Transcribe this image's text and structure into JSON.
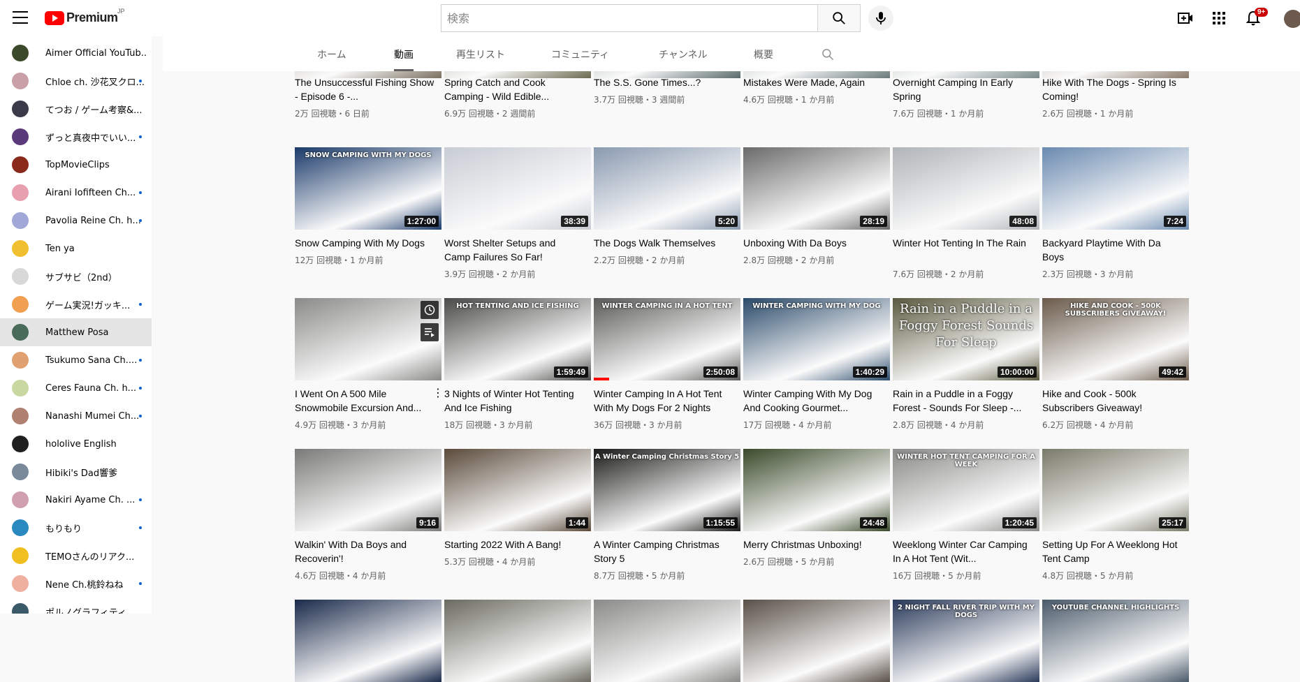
{
  "header": {
    "logo_text": "Premium",
    "logo_region": "JP",
    "search_placeholder": "検索",
    "notification_count": "9+"
  },
  "sidebar": {
    "items": [
      {
        "label": "Aimer Official YouTub...",
        "color": "#3b4a2a",
        "dot": false
      },
      {
        "label": "Chloe ch. 沙花叉クロ...",
        "color": "#c9a0a8",
        "dot": true
      },
      {
        "label": "てつお / ゲーム考察&...",
        "color": "#3a3a4a",
        "dot": false
      },
      {
        "label": "ずっと真夜中でいい...",
        "color": "#5a3a7a",
        "dot": true
      },
      {
        "label": "TopMovieClips",
        "color": "#8a2a1a",
        "dot": false
      },
      {
        "label": "Airani Iofifteen Ch...",
        "color": "#e8a0b0",
        "dot": true
      },
      {
        "label": "Pavolia Reine Ch. h...",
        "color": "#a0a8d8",
        "dot": true
      },
      {
        "label": "Ten ya",
        "color": "#f0c030",
        "dot": false
      },
      {
        "label": "サブサビ（2nd）",
        "color": "#d8d8d8",
        "dot": false
      },
      {
        "label": "ゲーム実況!ガッキ...",
        "color": "#f0a050",
        "dot": true
      },
      {
        "label": "Matthew Posa",
        "color": "#4a6a5a",
        "dot": false,
        "active": true
      },
      {
        "label": "Tsukumo Sana Ch....",
        "color": "#e0a070",
        "dot": true
      },
      {
        "label": "Ceres Fauna Ch. h...",
        "color": "#c8d8a0",
        "dot": true
      },
      {
        "label": "Nanashi Mumei Ch...",
        "color": "#b08070",
        "dot": true
      },
      {
        "label": "hololive English",
        "color": "#202020",
        "dot": false
      },
      {
        "label": "Hibiki's Dad響爹",
        "color": "#7a8a9a",
        "dot": false
      },
      {
        "label": "Nakiri Ayame Ch. ...",
        "color": "#d0a0b0",
        "dot": true
      },
      {
        "label": "もりもり",
        "color": "#2a8ac0",
        "dot": true
      },
      {
        "label": "TEMOさんのリアク...",
        "color": "#f0c020",
        "dot": false
      },
      {
        "label": "Nene Ch.桃鈴ねね",
        "color": "#f0b0a0",
        "dot": true
      },
      {
        "label": "ポルノグラフィティ",
        "color": "#3a5a6a",
        "dot": false
      }
    ]
  },
  "tabs": [
    "ホーム",
    "動画",
    "再生リスト",
    "コミュニティ",
    "チャンネル",
    "概要"
  ],
  "active_tab": "動画",
  "rows": [
    [
      {
        "title": "The Unsuccessful Fishing Show - Episode 6 -...",
        "meta": "2万 回視聴・6 日前",
        "color": "#7a7060"
      },
      {
        "title": "Spring Catch and Cook Camping - Wild Edible...",
        "meta": "6.9万 回視聴・2 週間前",
        "color": "#6a6a50"
      },
      {
        "title": "The S.S. Gone Times...?",
        "meta": "3.7万 回視聴・3 週間前",
        "color": "#5a6a6a"
      },
      {
        "title": "Mistakes Were Made, Again",
        "meta": "4.6万 回視聴・1 か月前",
        "color": "#6a7a7a"
      },
      {
        "title": "Overnight Camping In Early Spring",
        "meta": "7.6万 回視聴・1 か月前",
        "color": "#7a8a8a"
      },
      {
        "title": "Hike With The Dogs - Spring Is Coming!",
        "meta": "2.6万 回視聴・1 か月前",
        "color": "#8a7a6a"
      }
    ],
    [
      {
        "title": "Snow Camping With My Dogs",
        "meta": "12万 回視聴・1 か月前",
        "duration": "1:27:00",
        "overlay": "SNOW CAMPING WITH MY DOGS",
        "color": "#1a3a6a"
      },
      {
        "title": "Worst Shelter Setups and Camp Failures So Far!",
        "meta": "3.9万 回視聴・2 か月前",
        "duration": "38:39",
        "color": "#c8ccd4"
      },
      {
        "title": "The Dogs Walk Themselves",
        "meta": "2.2万 回視聴・2 か月前",
        "duration": "5:20",
        "color": "#8a9ab0"
      },
      {
        "title": "Unboxing With Da Boys",
        "meta": "2.8万 回視聴・2 か月前",
        "duration": "28:19",
        "color": "#6a6a6a"
      },
      {
        "title": "Winter Hot Tenting In The Rain",
        "meta": "7.6万 回視聴・2 か月前",
        "duration": "48:08",
        "color": "#b0b4b8"
      },
      {
        "title": "Backyard Playtime With Da Boys",
        "meta": "2.3万 回視聴・3 か月前",
        "duration": "7:24",
        "color": "#6a8ab0"
      }
    ],
    [
      {
        "title": "I Went On A 500 Mile Snowmobile Excursion And...",
        "meta": "4.9万 回視聴・3 か月前",
        "color": "#8a8a88",
        "hover": true
      },
      {
        "title": "3 Nights of Winter Hot Tenting And Ice Fishing",
        "meta": "18万 回視聴・3 か月前",
        "duration": "1:59:49",
        "overlay": "HOT TENTING AND ICE FISHING",
        "color": "#4a4a48"
      },
      {
        "title": "Winter Camping In A Hot Tent With My Dogs For 2 Nights",
        "meta": "36万 回視聴・3 か月前",
        "duration": "2:50:08",
        "overlay": "WINTER CAMPING IN A HOT TENT",
        "color": "#5a5a58",
        "progress": true
      },
      {
        "title": "Winter Camping With My Dog And Cooking Gourmet...",
        "meta": "17万 回視聴・4 か月前",
        "duration": "1:40:29",
        "overlay": "WINTER CAMPING WITH MY DOG",
        "color": "#2a4a6a"
      },
      {
        "title": "Rain in a Puddle in a Foggy Forest - Sounds For Sleep -...",
        "meta": "2.8万 回視聴・4 か月前",
        "duration": "10:00:00",
        "overlay_big": "Rain in a Puddle in a Foggy Forest Sounds For Sleep",
        "color": "#5a5a40"
      },
      {
        "title": "Hike and Cook - 500k Subscribers Giveaway!",
        "meta": "6.2万 回視聴・4 か月前",
        "duration": "49:42",
        "overlay": "HIKE AND COOK - 500K SUBSCRIBERS GIVEAWAY!",
        "color": "#6a5a4a"
      }
    ],
    [
      {
        "title": "Walkin' With Da Boys and Recoverin'!",
        "meta": "4.6万 回視聴・4 か月前",
        "duration": "9:16",
        "color": "#7a7a78"
      },
      {
        "title": "Starting 2022 With A Bang!",
        "meta": "5.3万 回視聴・4 か月前",
        "duration": "1:44",
        "color": "#5a4a3a"
      },
      {
        "title": "A Winter Camping Christmas Story 5",
        "meta": "8.7万 回視聴・5 か月前",
        "duration": "1:15:55",
        "overlay": "A Winter Camping Christmas Story 5",
        "color": "#1a1a18"
      },
      {
        "title": "Merry Christmas Unboxing!",
        "meta": "2.6万 回視聴・5 か月前",
        "duration": "24:48",
        "color": "#3a4a2a"
      },
      {
        "title": "Weeklong Winter Car Camping In A Hot Tent (Wit...",
        "meta": "16万 回視聴・5 か月前",
        "duration": "1:20:45",
        "overlay": "WINTER HOT TENT CAMPING FOR A WEEK",
        "color": "#8a8a88"
      },
      {
        "title": "Setting Up For A Weeklong Hot Tent Camp",
        "meta": "4.8万 回視聴・5 か月前",
        "duration": "25:17",
        "color": "#7a7a6a"
      }
    ],
    [
      {
        "title": "",
        "meta": "",
        "color": "#1a2a4a"
      },
      {
        "title": "",
        "meta": "",
        "color": "#6a6a60"
      },
      {
        "title": "",
        "meta": "",
        "color": "#8a8a88"
      },
      {
        "title": "",
        "meta": "",
        "color": "#5a5048"
      },
      {
        "title": "",
        "meta": "",
        "overlay": "2 NIGHT FALL RIVER TRIP WITH MY DOGS",
        "color": "#2a3a5a"
      },
      {
        "title": "",
        "meta": "",
        "overlay": "YOUTUBE CHANNEL HIGHLIGHTS",
        "color": "#4a5a6a"
      }
    ]
  ]
}
